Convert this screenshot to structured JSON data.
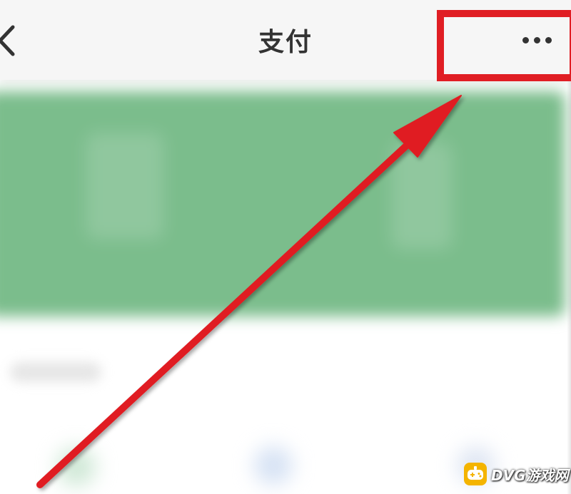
{
  "navbar": {
    "title": "支付",
    "back_icon": "chevron-left-icon",
    "more_icon": "more-horizontal-icon"
  },
  "annotation": {
    "box_color": "#e01e24",
    "arrow_color": "#e01e24"
  },
  "watermark": {
    "text": "DVG游戏网"
  },
  "colors": {
    "card_green": "#7bbd8c",
    "nav_background": "#f6f6f6",
    "title_color": "#333333",
    "watermark_logo": "#f4b400"
  }
}
